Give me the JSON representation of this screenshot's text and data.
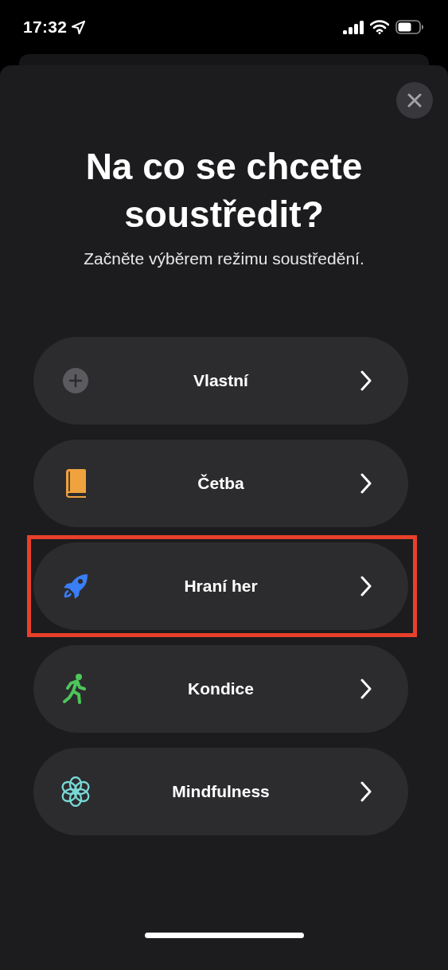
{
  "status_bar": {
    "time": "17:32"
  },
  "title": "Na co se chcete soustředit?",
  "subtitle": "Začněte výběrem režimu soustředění.",
  "modes": [
    {
      "label": "Vlastní",
      "kind": "plus",
      "color": "#5a5a5f",
      "highlighted": false
    },
    {
      "label": "Četba",
      "kind": "book",
      "color": "#f0a23e",
      "highlighted": false
    },
    {
      "label": "Hraní her",
      "kind": "rocket",
      "color": "#3a7ef5",
      "highlighted": true
    },
    {
      "label": "Kondice",
      "kind": "runner",
      "color": "#4dc55a",
      "highlighted": false
    },
    {
      "label": "Mindfulness",
      "kind": "flower",
      "color": "#79d8d6",
      "highlighted": false
    }
  ]
}
